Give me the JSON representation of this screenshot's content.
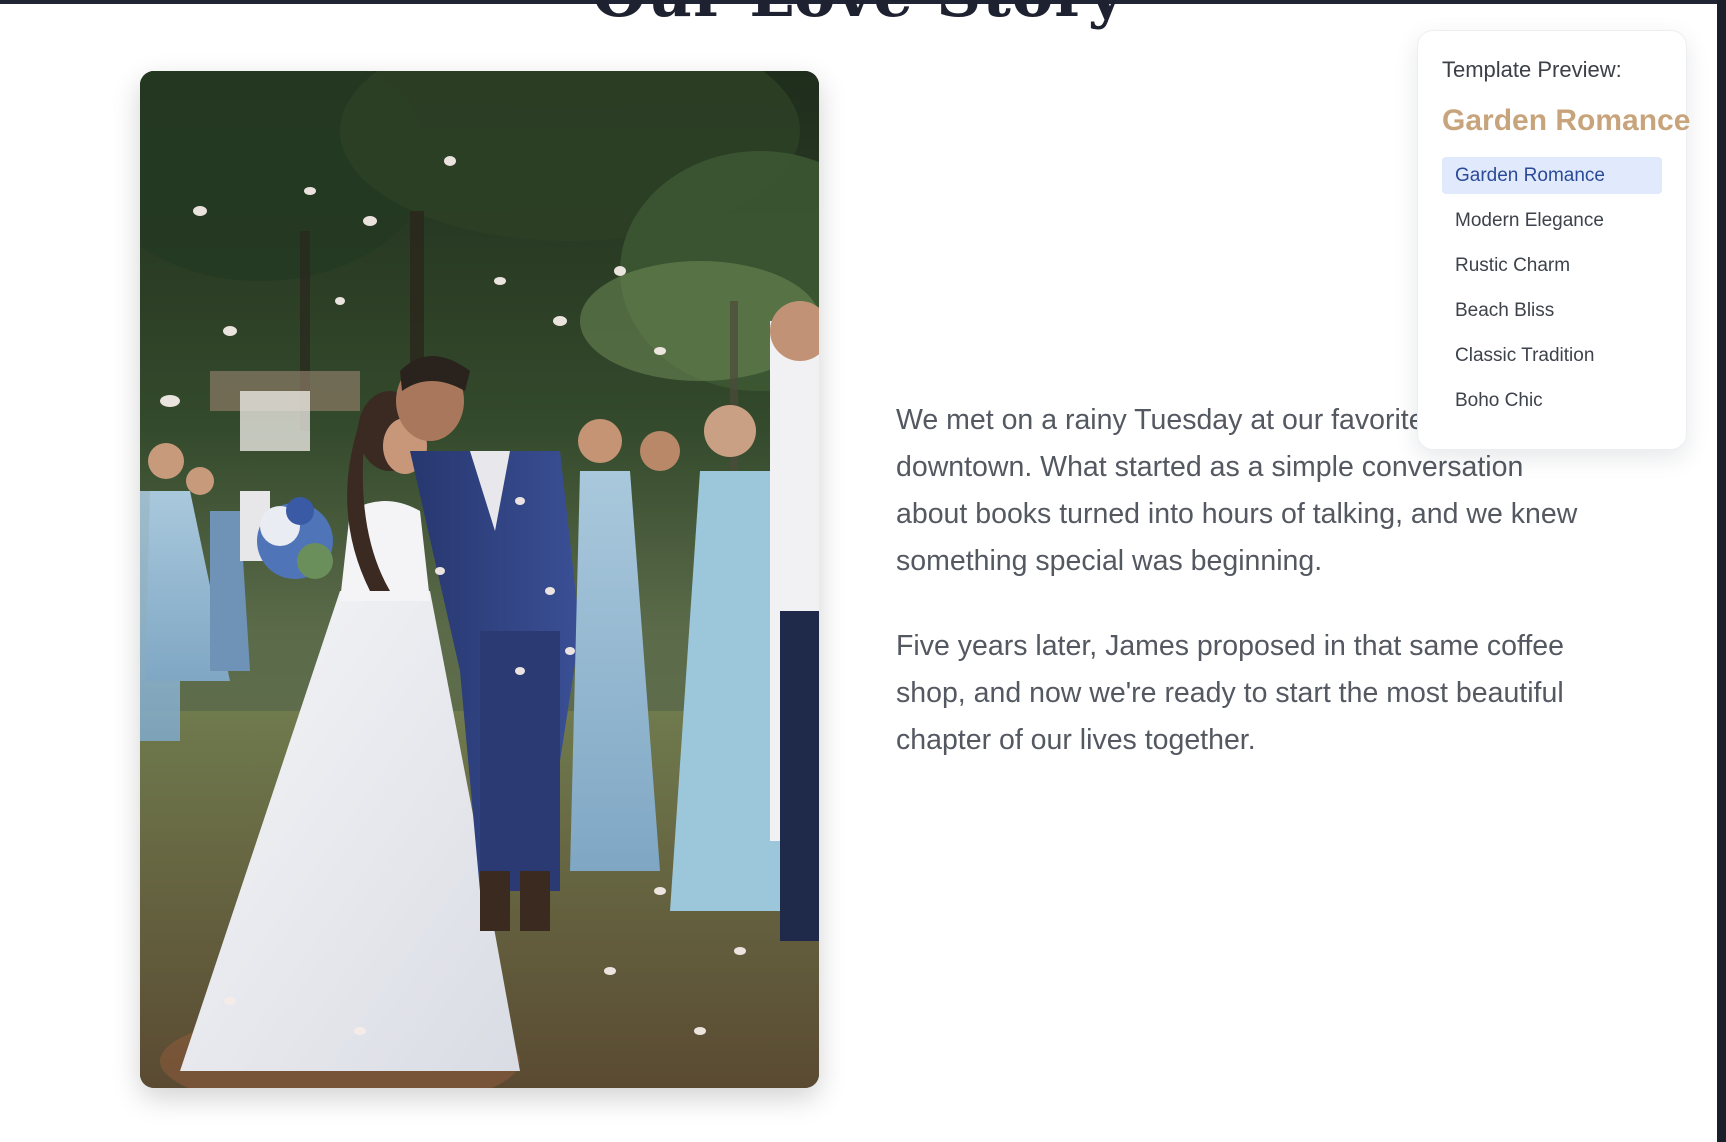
{
  "section": {
    "title": "Our Love Story"
  },
  "photo": {
    "alt": "Bride and groom kissing under falling petals"
  },
  "story": {
    "paragraphs": [
      "We met on a rainy Tuesday at our favorite coffee shop downtown. What started as a simple conversation about books turned into hours of talking, and we knew something special was beginning.",
      "Five years later, James proposed in that same coffee shop, and now we're ready to start the most beautiful chapter of our lives together."
    ]
  },
  "template_preview": {
    "label": "Template Preview:",
    "current": "Garden Romance",
    "options": [
      "Garden Romance",
      "Modern Elegance",
      "Rustic Charm",
      "Beach Bliss",
      "Classic Tradition",
      "Boho Chic"
    ],
    "selected_option": "Garden Romance"
  },
  "colors": {
    "accent": "#c8a47c",
    "selected_bg": "#e1eafc",
    "selected_text": "#2b4a97",
    "heading": "#1e2230"
  }
}
